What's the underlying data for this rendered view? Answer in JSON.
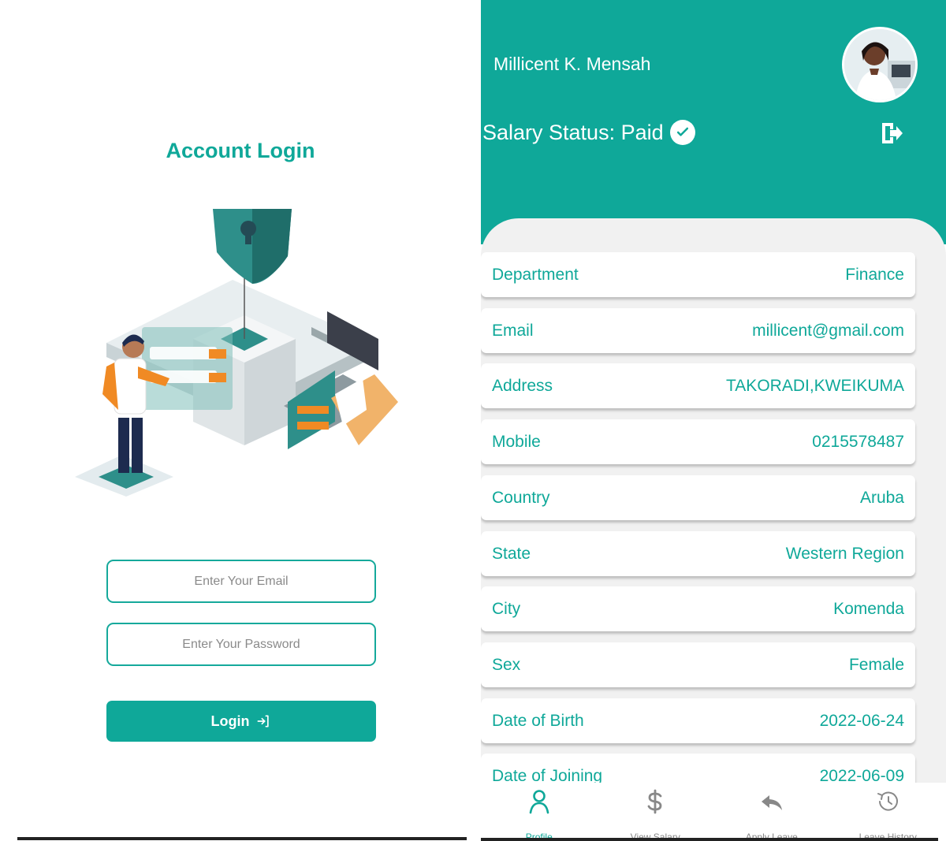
{
  "login": {
    "title": "Account Login",
    "email_placeholder": "Enter Your Email",
    "password_placeholder": "Enter Your Password",
    "login_label": "Login",
    "illustration_icon": "security-server-illustration"
  },
  "profile": {
    "user_name": "Millicent K. Mensah",
    "salary_status": "Salary Status: Paid",
    "status_icon": "check-circle-icon",
    "logout_icon": "logout-icon",
    "rows": [
      {
        "label": "Department",
        "value": "Finance"
      },
      {
        "label": "Email",
        "value": "millicent@gmail.com"
      },
      {
        "label": "Address",
        "value": "TAKORADI,KWEIKUMA"
      },
      {
        "label": "Mobile",
        "value": "0215578487"
      },
      {
        "label": "Country",
        "value": "Aruba"
      },
      {
        "label": "State",
        "value": "Western Region"
      },
      {
        "label": "City",
        "value": "Komenda"
      },
      {
        "label": "Sex",
        "value": "Female"
      },
      {
        "label": "Date of Birth",
        "value": "2022-06-24"
      },
      {
        "label": "Date of Joining",
        "value": "2022-06-09"
      }
    ]
  },
  "nav": {
    "items": [
      {
        "label": "Profile",
        "icon": "person-icon",
        "active": true
      },
      {
        "label": "View Salary",
        "icon": "dollar-icon",
        "active": false
      },
      {
        "label": "Apply Leave",
        "icon": "reply-icon",
        "active": false
      },
      {
        "label": "Leave History",
        "icon": "history-icon",
        "active": false
      }
    ]
  },
  "colors": {
    "accent": "#0fa899",
    "sheet_bg": "#f1f1f1",
    "nav_inactive": "#888888"
  }
}
